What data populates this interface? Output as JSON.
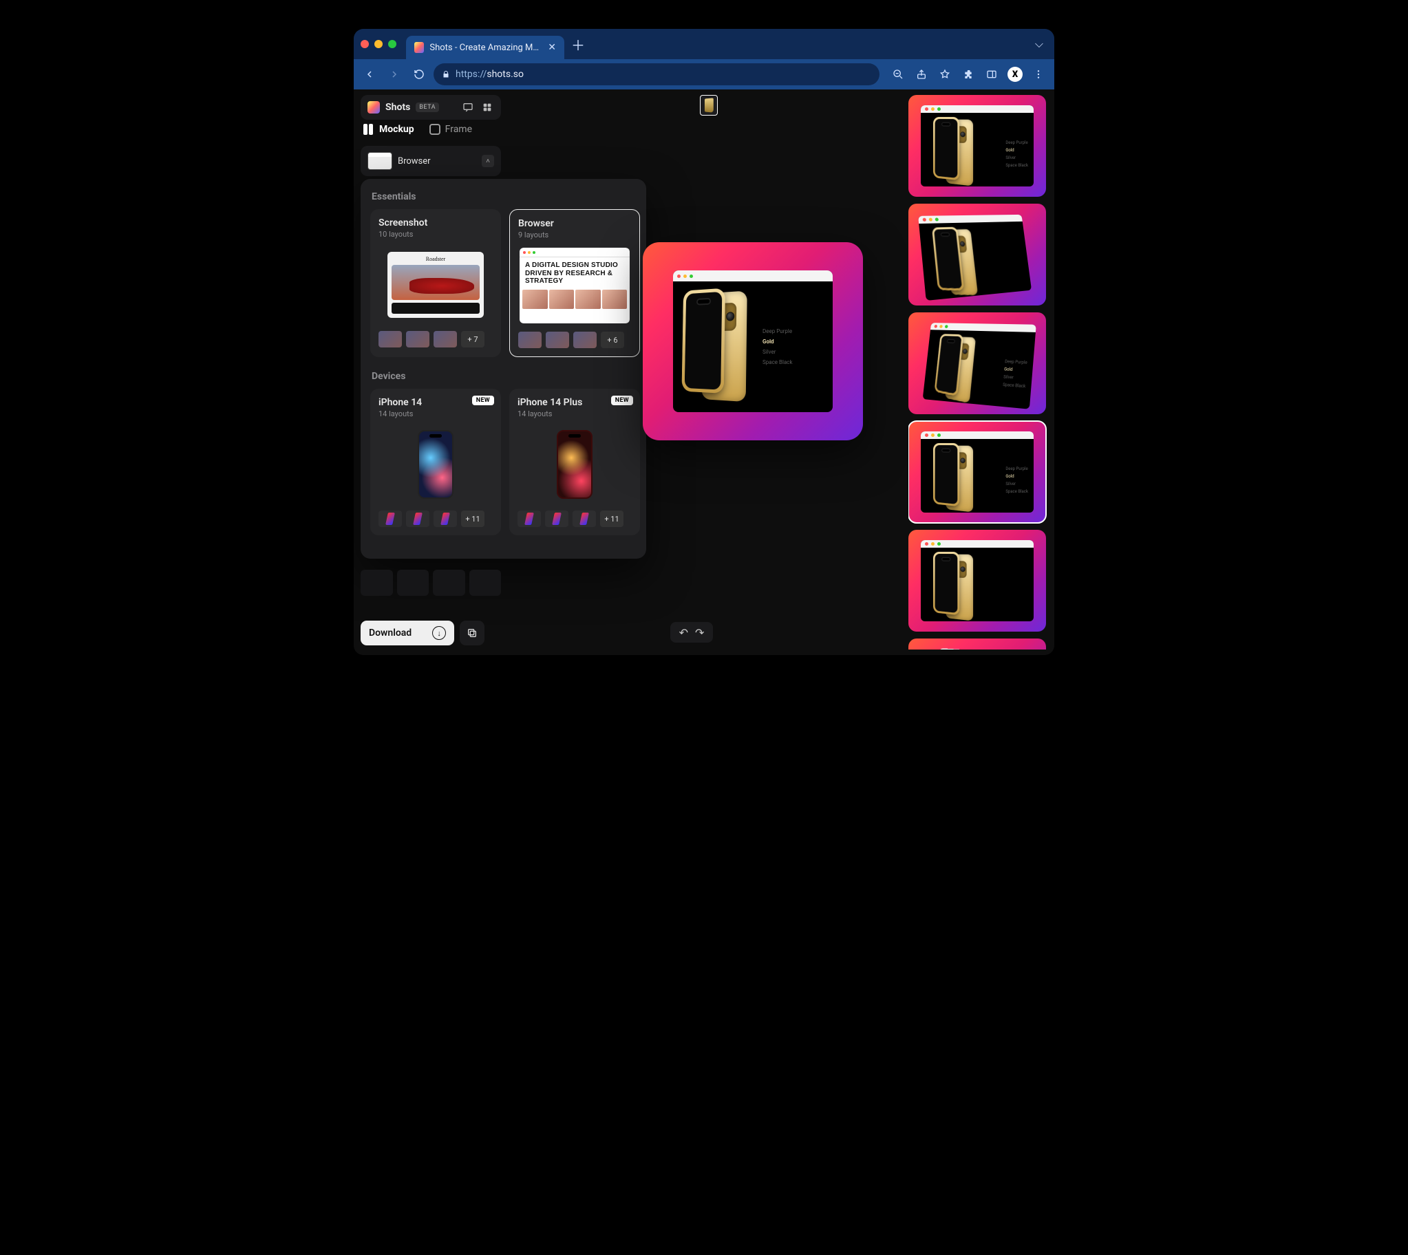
{
  "browser": {
    "tab_title": "Shots - Create Amazing Mocku",
    "url_proto": "https://",
    "url_host": "shots.so"
  },
  "app": {
    "name": "Shots",
    "badge": "BETA",
    "tabs": {
      "mockup": "Mockup",
      "frame": "Frame"
    },
    "selected_mockup": "Browser",
    "download": "Download"
  },
  "panel": {
    "section_essentials": "Essentials",
    "section_devices": "Devices",
    "cards": {
      "screenshot": {
        "title": "Screenshot",
        "sub": "10 layouts",
        "more": "+ 7"
      },
      "browser": {
        "title": "Browser",
        "sub": "9 layouts",
        "more": "+ 6",
        "preview_text": "A DIGITAL DESIGN STUDIO DRIVEN BY RESEARCH & STRATEGY"
      },
      "iphone14": {
        "title": "iPhone 14",
        "sub": "14 layouts",
        "badge": "NEW",
        "more": "+ 11"
      },
      "iphone14plus": {
        "title": "iPhone 14 Plus",
        "sub": "14 layouts",
        "badge": "NEW",
        "more": "+ 11"
      }
    },
    "screenshot_preview_name": "Roadster"
  },
  "mockup": {
    "colors": [
      "Deep Purple",
      "Gold",
      "Silver",
      "Space Black"
    ],
    "selected_color_index": 1
  }
}
